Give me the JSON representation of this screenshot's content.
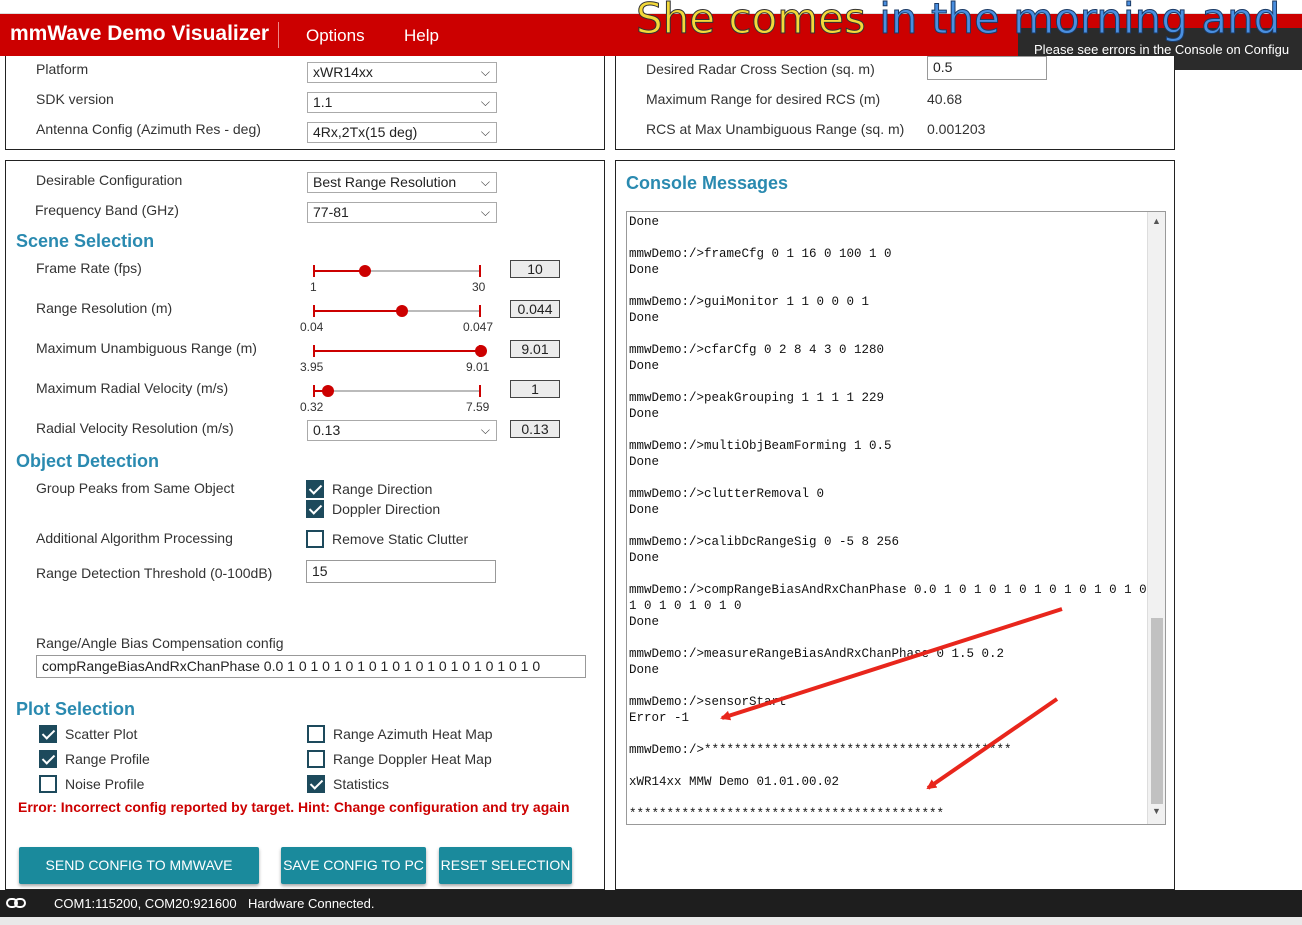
{
  "header": {
    "title": "mmWave Demo Visualizer",
    "menu": [
      "Options",
      "Help"
    ],
    "overlay_text_1": "She comes ",
    "overlay_text_2": "in the morning and",
    "toast": "Please see errors in the Console on Configu"
  },
  "platform_panel": {
    "platform_label": "Platform",
    "platform_value": "xWR14xx",
    "sdk_label": "SDK version",
    "sdk_value": "1.1",
    "antenna_label": "Antenna Config (Azimuth Res - deg)",
    "antenna_value": "4Rx,2Tx(15 deg)"
  },
  "rcs_panel": {
    "desired_rcs_label": "Desired Radar Cross Section (sq. m)",
    "desired_rcs_value": "0.5",
    "max_range_label": "Maximum Range for desired RCS (m)",
    "max_range_value": "40.68",
    "rcs_at_max_label": "RCS at Max Unambiguous Range (sq. m)",
    "rcs_at_max_value": "0.001203"
  },
  "config": {
    "desirable_label": "Desirable Configuration",
    "desirable_value": "Best Range Resolution",
    "freq_label": "Frequency Band (GHz)",
    "freq_value": "77-81"
  },
  "scene": {
    "heading": "Scene Selection",
    "frame_rate": {
      "label": "Frame Rate (fps)",
      "min": "1",
      "max": "30",
      "value": "10",
      "fraction": 0.31
    },
    "range_res": {
      "label": "Range Resolution (m)",
      "min": "0.04",
      "max": "0.047",
      "value": "0.044",
      "fraction": 0.53
    },
    "max_range": {
      "label": "Maximum Unambiguous Range (m)",
      "min": "3.95",
      "max": "9.01",
      "value": "9.01",
      "fraction": 1.0
    },
    "max_velocity": {
      "label": "Maximum Radial Velocity (m/s)",
      "min": "0.32",
      "max": "7.59",
      "value": "1",
      "fraction": 0.09
    },
    "vel_res": {
      "label": "Radial Velocity Resolution (m/s)",
      "value": "0.13",
      "box": "0.13"
    }
  },
  "detection": {
    "heading": "Object Detection",
    "group_label": "Group Peaks from Same Object",
    "range_direction": "Range Direction",
    "doppler_direction": "Doppler Direction",
    "additional_label": "Additional Algorithm Processing",
    "remove_clutter": "Remove Static Clutter",
    "threshold_label": "Range Detection Threshold (0-100dB)",
    "threshold_value": "15",
    "bias_label": "Range/Angle Bias Compensation config",
    "bias_value": "compRangeBiasAndRxChanPhase 0.0 1 0 1 0 1 0 1 0 1 0 1 0 1 0 1 0 1 0 1 0 1 0"
  },
  "plots": {
    "heading": "Plot Selection",
    "scatter": "Scatter Plot",
    "range_profile": "Range Profile",
    "noise_profile": "Noise Profile",
    "azimuth_heat": "Range Azimuth Heat Map",
    "doppler_heat": "Range Doppler Heat Map",
    "statistics": "Statistics"
  },
  "error": "Error: Incorrect config reported by target. Hint: Change configuration and try again",
  "buttons": {
    "send": "SEND CONFIG TO MMWAVE DEVICE",
    "save": "SAVE CONFIG TO PC",
    "reset": "RESET SELECTION"
  },
  "console": {
    "heading": "Console Messages",
    "lines": [
      "Done",
      "",
      "mmwDemo:/>frameCfg 0 1 16 0 100 1 0",
      "Done",
      "",
      "mmwDemo:/>guiMonitor 1 1 0 0 0 1",
      "Done",
      "",
      "mmwDemo:/>cfarCfg 0 2 8 4 3 0 1280",
      "Done",
      "",
      "mmwDemo:/>peakGrouping 1 1 1 1 229",
      "Done",
      "",
      "mmwDemo:/>multiObjBeamForming 1 0.5",
      "Done",
      "",
      "mmwDemo:/>clutterRemoval 0",
      "Done",
      "",
      "mmwDemo:/>calibDcRangeSig 0 -5 8 256",
      "Done",
      "",
      "mmwDemo:/>compRangeBiasAndRxChanPhase 0.0 1 0 1 0 1 0 1 0 1 0 1 0 1 0 1 0",
      "1 0 1 0 1 0 1 0",
      "Done",
      "",
      "mmwDemo:/>measureRangeBiasAndRxChanPhase 0 1.5 0.2",
      "Done",
      "",
      "mmwDemo:/>sensorStart",
      "Error -1",
      "",
      "mmwDemo:/>*****************************************",
      "",
      "xWR14xx MMW Demo 01.01.00.02",
      "",
      "******************************************"
    ]
  },
  "status": {
    "ports": "COM1:115200, COM20:921600",
    "connection": "Hardware Connected."
  },
  "colors": {
    "brand_red": "#cc0000",
    "section_blue": "#2a8ab0",
    "button_teal": "#1a8a9c",
    "checkbox_dark": "#1d4a5c",
    "annotation_arrow": "#e8261c"
  }
}
